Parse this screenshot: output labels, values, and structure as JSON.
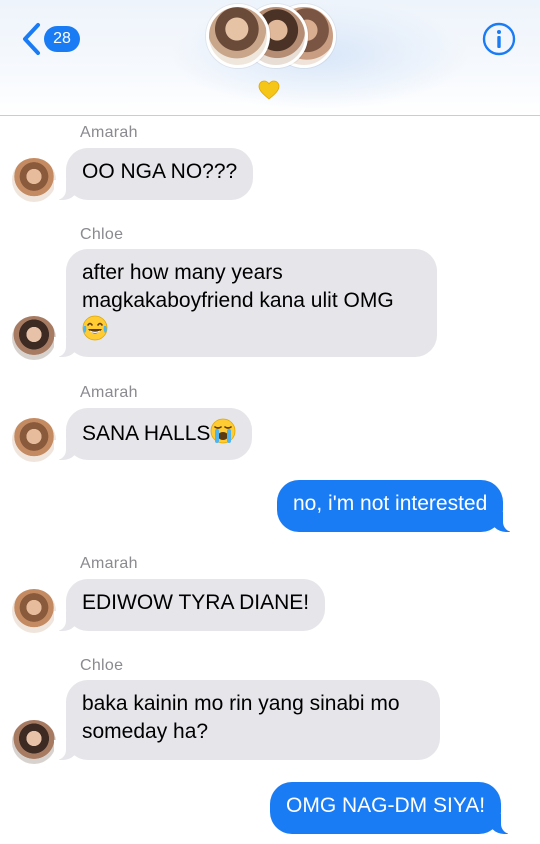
{
  "header": {
    "unread_count": "28",
    "back_icon": "chevron-left-icon",
    "info_icon": "info-icon",
    "heart_icon": "yellow-heart-icon",
    "accent_color": "#1a7cf5"
  },
  "messages": [
    {
      "sender": "Amarah",
      "direction": "incoming",
      "text": "OO NGA NO???"
    },
    {
      "sender": "Chloe",
      "direction": "incoming",
      "text": "after how many years\nmagkakaboyfriend kana ulit OMG",
      "emoji": "face-with-tears-of-joy"
    },
    {
      "sender": "Amarah",
      "direction": "incoming",
      "text": "SANA HALLS",
      "emoji": "loudly-crying-face"
    },
    {
      "direction": "outgoing",
      "text": "no, i'm not interested"
    },
    {
      "sender": "Amarah",
      "direction": "incoming",
      "text": "EDIWOW TYRA DIANE!"
    },
    {
      "sender": "Chloe",
      "direction": "incoming",
      "text": "baka kainin mo rin yang sinabi mo\nsomeday ha?"
    },
    {
      "direction": "outgoing",
      "text": "OMG NAG-DM SIYA!"
    }
  ],
  "colors": {
    "incoming_bubble": "#e5e5ea",
    "outgoing_bubble": "#1a7cf5",
    "sender_name": "#8a8a8f"
  }
}
